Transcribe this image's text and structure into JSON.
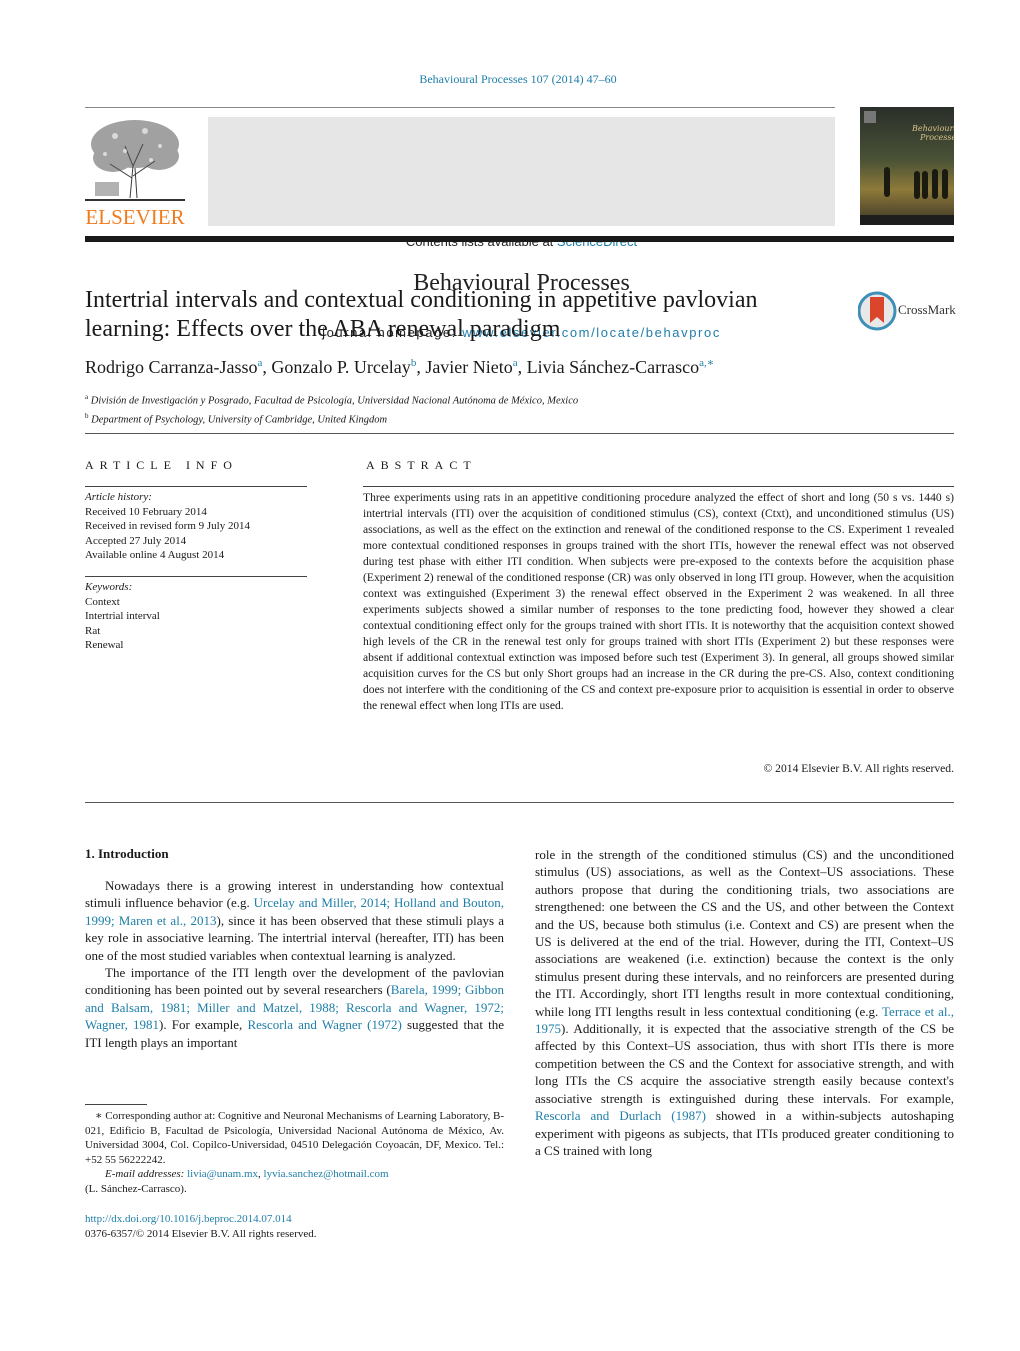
{
  "header": {
    "citation": "Behavioural Processes 107 (2014) 47–60",
    "contents_prefix": "Contents lists available at ",
    "contents_link": "ScienceDirect",
    "journal_title": "Behavioural Processes",
    "homepage_prefix": "journal homepage: ",
    "homepage_link": "www.elsevier.com/locate/behavproc",
    "publisher_logo_text": "ELSEVIER",
    "colors": {
      "link": "#1f7ea8",
      "elsevier_orange": "#f07c1e",
      "banner_bg": "#e6e6e6"
    }
  },
  "article": {
    "title": "Intertrial intervals and contextual conditioning in appetitive pavlovian learning: Effects over the ABA renewal paradigm",
    "crossmark_label": "CrossMark",
    "authors": [
      {
        "name": "Rodrigo Carranza-Jasso",
        "sup": "a"
      },
      {
        "name": "Gonzalo P. Urcelay",
        "sup": "b"
      },
      {
        "name": "Javier Nieto",
        "sup": "a"
      },
      {
        "name": "Livia Sánchez-Carrasco",
        "sup": "a,∗"
      }
    ],
    "affiliations": [
      {
        "sup": "a",
        "text": "División de Investigación y Posgrado, Facultad de Psicología, Universidad Nacional Autónoma de México, Mexico"
      },
      {
        "sup": "b",
        "text": "Department of Psychology, University of Cambridge, United Kingdom"
      }
    ]
  },
  "article_info": {
    "heading": "ARTICLE INFO",
    "history_label": "Article history:",
    "history": [
      "Received 10 February 2014",
      "Received in revised form 9 July 2014",
      "Accepted 27 July 2014",
      "Available online 4 August 2014"
    ],
    "keywords_label": "Keywords:",
    "keywords": [
      "Context",
      "Intertrial interval",
      "Rat",
      "Renewal"
    ]
  },
  "abstract": {
    "heading": "ABSTRACT",
    "text": "Three experiments using rats in an appetitive conditioning procedure analyzed the effect of short and long (50 s vs. 1440 s) intertrial intervals (ITI) over the acquisition of conditioned stimulus (CS), context (Ctxt), and unconditioned stimulus (US) associations, as well as the effect on the extinction and renewal of the conditioned response to the CS. Experiment 1 revealed more contextual conditioned responses in groups trained with the short ITIs, however the renewal effect was not observed during test phase with either ITI condition. When subjects were pre-exposed to the contexts before the acquisition phase (Experiment 2) renewal of the conditioned response (CR) was only observed in long ITI group. However, when the acquisition context was extinguished (Experiment 3) the renewal effect observed in the Experiment 2 was weakened. In all three experiments subjects showed a similar number of responses to the tone predicting food, however they showed a clear contextual conditioning effect only for the groups trained with short ITIs. It is noteworthy that the acquisition context showed high levels of the CR in the renewal test only for groups trained with short ITIs (Experiment 2) but these responses were absent if additional contextual extinction was imposed before such test (Experiment 3). In general, all groups showed similar acquisition curves for the CS but only Short groups had an increase in the CR during the pre-CS. Also, context conditioning does not interfere with the conditioning of the CS and context pre-exposure prior to acquisition is essential in order to observe the renewal effect when long ITIs are used.",
    "copyright": "© 2014 Elsevier B.V. All rights reserved."
  },
  "body": {
    "section_heading": "1.  Introduction",
    "left_paragraphs": [
      [
        {
          "t": "Nowadays there is a growing interest in understanding how contextual stimuli influence behavior (e.g. "
        },
        {
          "t": "Urcelay and Miller, 2014; Holland and Bouton, 1999; Maren et al., 2013",
          "link": true
        },
        {
          "t": "), since it has been observed that these stimuli plays a key role in associative learning. The intertrial interval (hereafter, ITI) has been one of the most studied variables when contextual learning is analyzed."
        }
      ],
      [
        {
          "t": "The importance of the ITI length over the development of the pavlovian conditioning has been pointed out by several researchers ("
        },
        {
          "t": "Barela, 1999; Gibbon and Balsam, 1981; Miller and Matzel, 1988; Rescorla and Wagner, 1972; Wagner, 1981",
          "link": true
        },
        {
          "t": "). For example, "
        },
        {
          "t": "Rescorla and Wagner (1972)",
          "link": true
        },
        {
          "t": " suggested that the ITI length plays an important"
        }
      ]
    ],
    "right_paragraphs": [
      [
        {
          "t": "role in the strength of the conditioned stimulus (CS) and the unconditioned stimulus (US) associations, as well as the Context–US associations. These authors propose that during the conditioning trials, two associations are strengthened: one between the CS and the US, and other between the Context and the US, because both stimulus (i.e. Context and CS) are present when the US is delivered at the end of the trial. However, during the ITI, Context–US associations are weakened (i.e. extinction) because the context is the only stimulus present during these intervals, and no reinforcers are presented during the ITI. Accordingly, short ITI lengths result in more contextual conditioning, while long ITI lengths result in less contextual conditioning (e.g. "
        },
        {
          "t": "Terrace et al., 1975",
          "link": true
        },
        {
          "t": "). Additionally, it is expected that the associative strength of the CS be affected by this Context–US association, thus with short ITIs there is more competition between the CS and the Context for associative strength, and with long ITIs the CS acquire the associative strength easily because context's associative strength is extinguished during these intervals. For example, "
        },
        {
          "t": "Rescorla and Durlach (1987)",
          "link": true
        },
        {
          "t": " showed in a within-subjects autoshaping experiment with pigeons as subjects, that ITIs produced greater conditioning to a CS trained with long"
        }
      ]
    ]
  },
  "footnote": {
    "marker": "∗",
    "corresponding": "Corresponding author at: Cognitive and Neuronal Mechanisms of Learning Laboratory, B-021, Edificio B, Facultad de Psicología, Universidad Nacional Autónoma de México, Av. Universidad 3004, Col. Copilco-Universidad, 04510 Delegación Coyoacán, DF, Mexico. Tel.: +52 55 56222242.",
    "email_label": "E-mail addresses: ",
    "emails": [
      "livia@unam.mx",
      "lyvia.sanchez@hotmail.com"
    ],
    "email_owner": "(L. Sánchez-Carrasco).",
    "doi": "http://dx.doi.org/10.1016/j.beproc.2014.07.014",
    "issn_copyright": "0376-6357/© 2014 Elsevier B.V. All rights reserved."
  }
}
